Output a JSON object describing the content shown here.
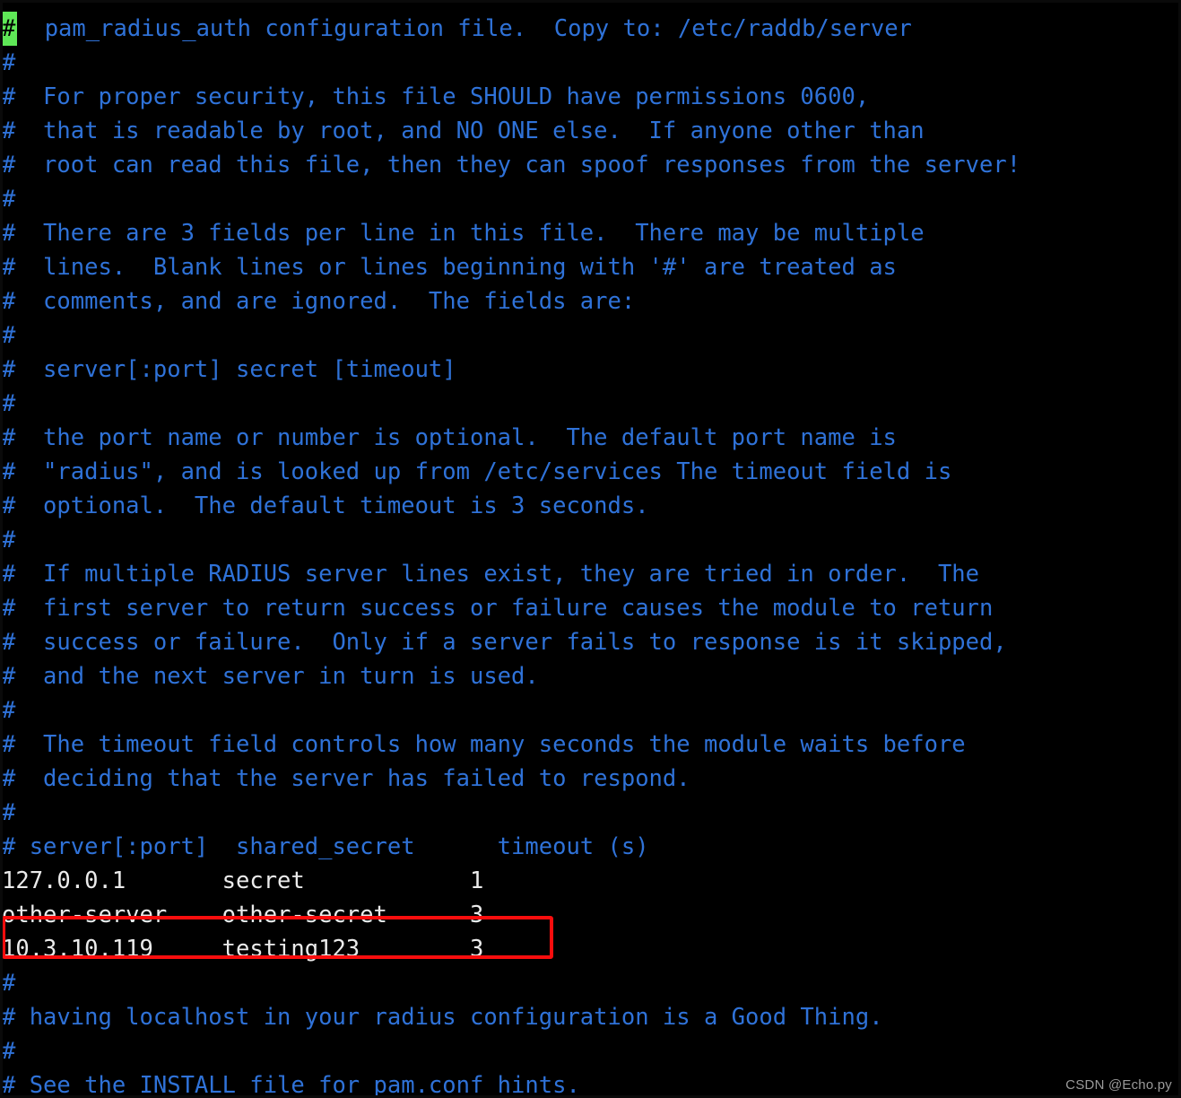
{
  "app": {
    "kind": "terminal-text-editor",
    "background_color": "#000000",
    "comment_color": "#2f72d8",
    "data_color": "#ebebeb",
    "cursor_color": "#5fe857",
    "annotation_color": "#f90d0d"
  },
  "cursor": {
    "char": "#",
    "line_index": 0,
    "column_index": 0
  },
  "file": {
    "lines": [
      {
        "type": "comment",
        "text": "#  pam_radius_auth configuration file.  Copy to: /etc/raddb/server"
      },
      {
        "type": "comment",
        "text": "#"
      },
      {
        "type": "comment",
        "text": "#  For proper security, this file SHOULD have permissions 0600,"
      },
      {
        "type": "comment",
        "text": "#  that is readable by root, and NO ONE else.  If anyone other than"
      },
      {
        "type": "comment",
        "text": "#  root can read this file, then they can spoof responses from the server!"
      },
      {
        "type": "comment",
        "text": "#"
      },
      {
        "type": "comment",
        "text": "#  There are 3 fields per line in this file.  There may be multiple"
      },
      {
        "type": "comment",
        "text": "#  lines.  Blank lines or lines beginning with '#' are treated as"
      },
      {
        "type": "comment",
        "text": "#  comments, and are ignored.  The fields are:"
      },
      {
        "type": "comment",
        "text": "#"
      },
      {
        "type": "comment",
        "text": "#  server[:port] secret [timeout]"
      },
      {
        "type": "comment",
        "text": "#"
      },
      {
        "type": "comment",
        "text": "#  the port name or number is optional.  The default port name is"
      },
      {
        "type": "comment",
        "text": "#  \"radius\", and is looked up from /etc/services The timeout field is"
      },
      {
        "type": "comment",
        "text": "#  optional.  The default timeout is 3 seconds."
      },
      {
        "type": "comment",
        "text": "#"
      },
      {
        "type": "comment",
        "text": "#  If multiple RADIUS server lines exist, they are tried in order.  The"
      },
      {
        "type": "comment",
        "text": "#  first server to return success or failure causes the module to return"
      },
      {
        "type": "comment",
        "text": "#  success or failure.  Only if a server fails to response is it skipped,"
      },
      {
        "type": "comment",
        "text": "#  and the next server in turn is used."
      },
      {
        "type": "comment",
        "text": "#"
      },
      {
        "type": "comment",
        "text": "#  The timeout field controls how many seconds the module waits before"
      },
      {
        "type": "comment",
        "text": "#  deciding that the server has failed to respond."
      },
      {
        "type": "comment",
        "text": "#"
      },
      {
        "type": "comment",
        "text": "# server[:port]  shared_secret      timeout (s)"
      },
      {
        "type": "data",
        "text": "127.0.0.1       secret            1"
      },
      {
        "type": "data",
        "text": "other-server    other-secret      3"
      },
      {
        "type": "data",
        "text": "10.3.10.119     testing123        3"
      },
      {
        "type": "comment",
        "text": "#"
      },
      {
        "type": "comment",
        "text": "# having localhost in your radius configuration is a Good Thing."
      },
      {
        "type": "comment",
        "text": "#"
      },
      {
        "type": "comment",
        "text": "# See the INSTALL file for pam.conf hints."
      }
    ]
  },
  "server_table": {
    "columns": [
      "server[:port]",
      "shared_secret",
      "timeout (s)"
    ],
    "rows": [
      {
        "server": "127.0.0.1",
        "shared_secret": "secret",
        "timeout": "1",
        "highlighted": false
      },
      {
        "server": "other-server",
        "shared_secret": "other-secret",
        "timeout": "3",
        "highlighted": false
      },
      {
        "server": "10.3.10.119",
        "shared_secret": "testing123",
        "timeout": "3",
        "highlighted": true
      }
    ]
  },
  "annotation": {
    "shape": "rectangle",
    "color": "#f90d0d",
    "target_line_index": 27,
    "target_text": "10.3.10.119     testing123        3"
  },
  "watermark": {
    "text": "CSDN @Echo.py"
  }
}
